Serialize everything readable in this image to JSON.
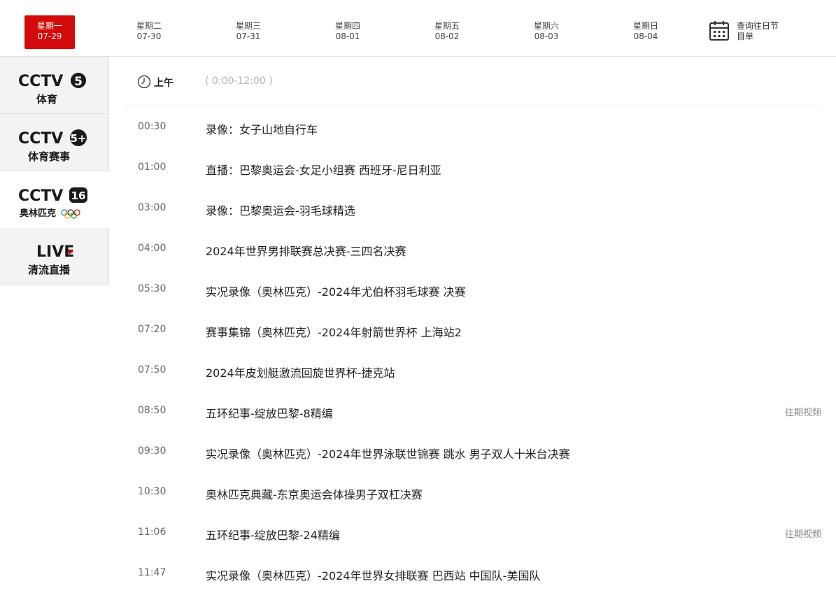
{
  "dates": [
    {
      "weekday": "星期一",
      "date": "07-29",
      "active": true
    },
    {
      "weekday": "星期二",
      "date": "07-30"
    },
    {
      "weekday": "星期三",
      "date": "07-31"
    },
    {
      "weekday": "星期四",
      "date": "08-01"
    },
    {
      "weekday": "星期五",
      "date": "08-02"
    },
    {
      "weekday": "星期六",
      "date": "08-03"
    },
    {
      "weekday": "星期日",
      "date": "08-04"
    }
  ],
  "query": {
    "label_line1": "查询往日节",
    "label_line2": "目单",
    "icon": "calendar-icon"
  },
  "channels": [
    {
      "logo": "CCTV",
      "number": "5",
      "subtitle": "体育",
      "active": false
    },
    {
      "logo": "CCTV",
      "number": "5+",
      "subtitle": "体育赛事",
      "active": false
    },
    {
      "logo": "CCTV",
      "number": "16",
      "subtitle": "奥林匹克",
      "active": true
    },
    {
      "logo": "LIVE",
      "subtitle": "清流直播",
      "active": false
    }
  ],
  "period": {
    "label": "上午",
    "range": "( 0:00-12:00 )",
    "icon": "clock-icon"
  },
  "programs": [
    {
      "time": "00:30",
      "title": "录像：女子山地自行车"
    },
    {
      "time": "01:00",
      "title": "直播：巴黎奥运会-女足小组赛 西班牙-尼日利亚"
    },
    {
      "time": "03:00",
      "title": "录像：巴黎奥运会-羽毛球精选"
    },
    {
      "time": "04:00",
      "title": "2024年世界男排联赛总决赛-三四名决赛"
    },
    {
      "time": "05:30",
      "title": "实况录像（奥林匹克）-2024年尤伯杯羽毛球赛 决赛"
    },
    {
      "time": "07:20",
      "title": "赛事集锦（奥林匹克）-2024年射箭世界杯 上海站2"
    },
    {
      "time": "07:50",
      "title": "2024年皮划艇激流回旋世界杯-捷克站"
    },
    {
      "time": "08:50",
      "title": "五环纪事-绽放巴黎-8精编",
      "replay": "往期视频"
    },
    {
      "time": "09:30",
      "title": "实况录像（奥林匹克）-2024年世界泳联世锦赛 跳水 男子双人十米台决赛"
    },
    {
      "time": "10:30",
      "title": "奥林匹克典藏-东京奥运会体操男子双杠决赛"
    },
    {
      "time": "11:06",
      "title": "五环纪事-绽放巴黎-24精编",
      "replay": "往期视频"
    },
    {
      "time": "11:47",
      "title": "实况录像（奥林匹克）-2024年世界女排联赛 巴西站 中国队-美国队"
    }
  ],
  "colors": {
    "accent": "#d20a0a",
    "text": "#222222",
    "muted": "#666666",
    "divider": "#dcdcdc"
  }
}
